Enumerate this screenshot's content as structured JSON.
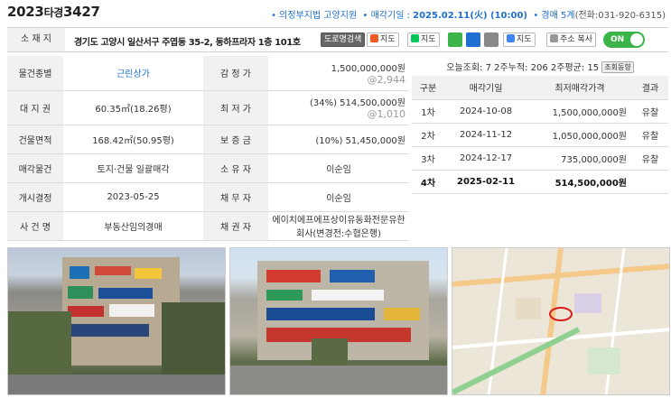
{
  "header": {
    "case_year": "2023",
    "case_type": "타경",
    "case_num": "3427",
    "court_prefix": "• ",
    "court": "의정부지법 고양지원",
    "date_label": "• 매각기일 : ",
    "date_value": "2025.02.11(火) (10:00)",
    "dept_prefix": "• ",
    "dept": "경매 5계",
    "phone": "(전화:031-920-6315)"
  },
  "address": {
    "label": "소 재 지",
    "text": "경기도 고양시 일산서구 주엽동 35-2, 동하프라자 1층 101호",
    "buttons": {
      "road_name": "도로명검색",
      "daum_map": "지도",
      "naver_map": "지도",
      "google_map": "지도",
      "copy_addr": "주소 복사"
    },
    "toggle_label": "ON"
  },
  "info": {
    "rows": [
      {
        "l1": "물건종별",
        "v1": "근린상가",
        "l2": "감 정 가",
        "v2": "1,500,000,000원",
        "v2sub": "@2,944"
      },
      {
        "l1": "대 지 권",
        "v1": "60.35㎡(18.26평)",
        "l2": "최 저 가",
        "v2": "(34%) 514,500,000원",
        "v2sub": "@1,010"
      },
      {
        "l1": "건물면적",
        "v1": "168.42㎡(50.95평)",
        "l2": "보 증 금",
        "v2": "(10%) 51,450,000원",
        "v2sub": ""
      },
      {
        "l1": "매각물건",
        "v1": "토지·건물 일괄매각",
        "l2": "소 유 자",
        "v2": "이순임",
        "v2sub": ""
      },
      {
        "l1": "개시결정",
        "v1": "2023-05-25",
        "l2": "채 무 자",
        "v2": "이순임",
        "v2sub": ""
      },
      {
        "l1": "사 건 명",
        "v1": "부동산임의경매",
        "l2": "채 권 자",
        "v2": "에이치에프에프상이유동화전문유한회사(변경전:수협은행)",
        "v2sub": ""
      }
    ]
  },
  "stats": {
    "text": "오늘조회: 7  2주누적: 206  2주평균: 15",
    "badge": "조회동향"
  },
  "auction": {
    "headers": [
      "구분",
      "매각기일",
      "최저매각가격",
      "결과"
    ],
    "rows": [
      {
        "round": "1차",
        "date": "2024-10-08",
        "price": "1,500,000,000원",
        "result": "유찰"
      },
      {
        "round": "2차",
        "date": "2024-11-12",
        "price": "1,050,000,000원",
        "result": "유찰"
      },
      {
        "round": "3차",
        "date": "2024-12-17",
        "price": "735,000,000원",
        "result": "유찰"
      },
      {
        "round": "4차",
        "date": "2025-02-11",
        "price": "514,500,000원",
        "result": ""
      }
    ]
  },
  "colors": {
    "accent_blue": "#1e6fd0",
    "toggle_green": "#3bb54a",
    "label_bg": "#f1f1f1"
  }
}
